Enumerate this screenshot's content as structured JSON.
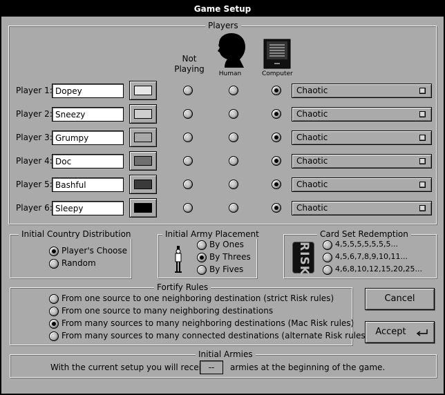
{
  "window": {
    "title": "Game Setup"
  },
  "players": {
    "legend": "Players",
    "col_not_playing": "Not Playing",
    "col_human": "Human",
    "col_computer": "Computer",
    "rows": [
      {
        "label": "Player 1:",
        "name": "Dopey",
        "swatch_color": "#e6e6e6",
        "mode": "computer",
        "strategy": "Chaotic"
      },
      {
        "label": "Player 2:",
        "name": "Sneezy",
        "swatch_color": "#cfcfcf",
        "mode": "computer",
        "strategy": "Chaotic"
      },
      {
        "label": "Player 3:",
        "name": "Grumpy",
        "swatch_color": "#a8a8a8",
        "mode": "computer",
        "strategy": "Chaotic"
      },
      {
        "label": "Player 4:",
        "name": "Doc",
        "swatch_color": "#6e6e6e",
        "mode": "computer",
        "strategy": "Chaotic"
      },
      {
        "label": "Player 5:",
        "name": "Bashful",
        "swatch_color": "#3a3a3a",
        "mode": "computer",
        "strategy": "Chaotic"
      },
      {
        "label": "Player 6:",
        "name": "Sleepy",
        "swatch_color": "#000000",
        "mode": "computer",
        "strategy": "Chaotic"
      }
    ]
  },
  "distribution": {
    "legend": "Initial Country Distribution",
    "options": [
      "Player's Choose",
      "Random"
    ],
    "selected": 0
  },
  "placement": {
    "legend": "Initial Army Placement",
    "options": [
      "By Ones",
      "By Threes",
      "By Fives"
    ],
    "selected": 1
  },
  "redemption": {
    "legend": "Card Set Redemption",
    "logo_text": "RISK",
    "options": [
      "4,5,5,5,5,5,5,5...",
      "4,5,6,7,8,9,10,11...",
      "4,6,8,10,12,15,20,25..."
    ],
    "selected": -1
  },
  "fortify": {
    "legend": "Fortify Rules",
    "options": [
      "From one source to one neighboring destination (strict Risk rules)",
      "From one source to many neighboring destinations",
      "From many sources to many neighboring destinations (Mac Risk rules)",
      "From many sources to many connected destinations (alternate Risk rules)"
    ],
    "selected": 2
  },
  "buttons": {
    "cancel": "Cancel",
    "accept": "Accept"
  },
  "initial_armies": {
    "legend": "Initial Armies",
    "text_before": "With the current setup you will receive",
    "value": "--",
    "text_after": "armies at the beginning of the game."
  }
}
